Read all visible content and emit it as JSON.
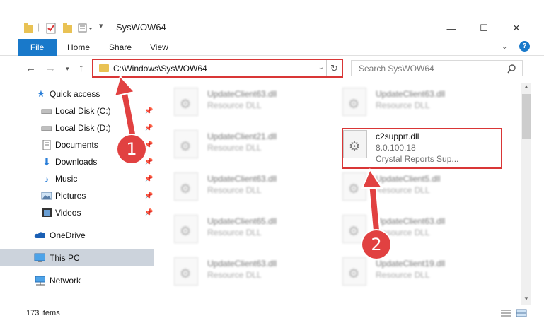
{
  "window": {
    "title": "SysWOW64",
    "minimize_glyph": "—",
    "maximize_glyph": "☐",
    "close_glyph": "✕"
  },
  "ribbon": {
    "tabs": [
      "File",
      "Home",
      "Share",
      "View"
    ],
    "help_glyph": "?"
  },
  "address": {
    "path": "C:\\Windows\\SysWOW64",
    "search_placeholder": "Search SysWOW64"
  },
  "sidebar": {
    "items": [
      {
        "label": "Quick access",
        "icon": "star-icon"
      },
      {
        "label": "Local Disk (C:)",
        "icon": "drive-icon"
      },
      {
        "label": "Local Disk (D:)",
        "icon": "drive-icon"
      },
      {
        "label": "Documents",
        "icon": "documents-icon"
      },
      {
        "label": "Downloads",
        "icon": "downloads-icon"
      },
      {
        "label": "Music",
        "icon": "music-icon"
      },
      {
        "label": "Pictures",
        "icon": "pictures-icon"
      },
      {
        "label": "Videos",
        "icon": "videos-icon"
      },
      {
        "label": "OneDrive",
        "icon": "cloud-icon"
      },
      {
        "label": "This PC",
        "icon": "computer-icon"
      },
      {
        "label": "Network",
        "icon": "network-icon"
      }
    ]
  },
  "files": [
    {
      "name": "UpdateClient63.dll",
      "line2": "Resource DLL",
      "line3": ""
    },
    {
      "name": "UpdateClient63.dll",
      "line2": "Resource DLL",
      "line3": ""
    },
    {
      "name": "UpdateClient21.dll",
      "line2": "Resource DLL",
      "line3": ""
    },
    {
      "name": "c2supprt.dll",
      "line2": "8.0.100.18",
      "line3": "Crystal Reports Sup..."
    },
    {
      "name": "UpdateClient63.dll",
      "line2": "Resource DLL",
      "line3": ""
    },
    {
      "name": "UpdateClient5.dll",
      "line2": "Resource DLL",
      "line3": ""
    },
    {
      "name": "UpdateClient65.dll",
      "line2": "Resource DLL",
      "line3": ""
    },
    {
      "name": "UpdateClient63.dll",
      "line2": "Resource DLL",
      "line3": ""
    },
    {
      "name": "UpdateClient63.dll",
      "line2": "Resource DLL",
      "line3": ""
    },
    {
      "name": "UpdateClient19.dll",
      "line2": "Resource DLL",
      "line3": ""
    }
  ],
  "status": {
    "item_count": "173 items"
  },
  "annotations": {
    "step1": "1",
    "step2": "2"
  },
  "colors": {
    "accent": "#1979ca",
    "highlight_red": "#d93636",
    "callout_red": "#e14141",
    "selected_bg": "#ccd3dc"
  }
}
